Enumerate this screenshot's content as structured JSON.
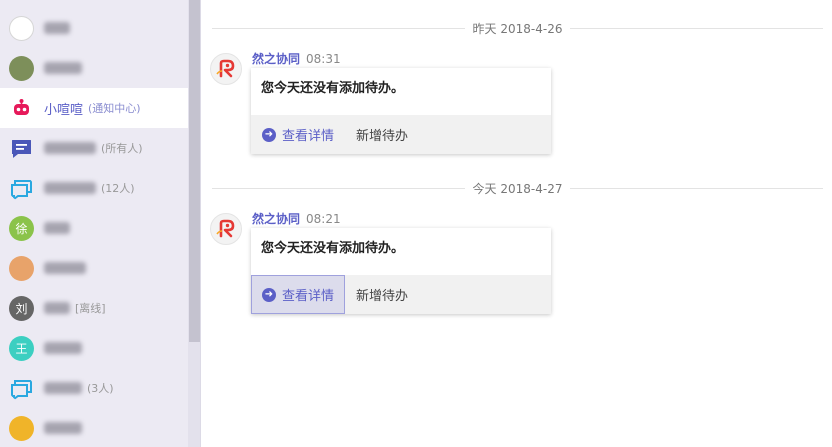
{
  "sidebar": {
    "items": [
      {
        "name": "",
        "sub": "",
        "avatar_text": "",
        "avatar_color": "#ffffff",
        "blur_w": 26
      },
      {
        "name": "",
        "sub": "",
        "avatar_text": "",
        "avatar_color": "#7d8f5a",
        "blur_w": 38
      },
      {
        "name": "小喧喧",
        "sub": "(通知中心)",
        "avatar_text": "",
        "avatar_color": "#e6195a"
      },
      {
        "name": "",
        "sub": "(所有人)",
        "avatar_text": "",
        "avatar_color": "#4a57b8",
        "blur_w": 52
      },
      {
        "name": "",
        "sub": "(12人)",
        "avatar_text": "",
        "avatar_color": "#2aa8e0",
        "blur_w": 52
      },
      {
        "name": "",
        "sub": "",
        "avatar_text": "徐",
        "avatar_color": "#8bc34a",
        "blur_w": 26
      },
      {
        "name": "",
        "sub": "",
        "avatar_text": "",
        "avatar_color": "#e8a36a",
        "blur_w": 42
      },
      {
        "name": "",
        "sub": "[离线]",
        "avatar_text": "刘",
        "avatar_color": "#666666",
        "blur_w": 26
      },
      {
        "name": "",
        "sub": "",
        "avatar_text": "王",
        "avatar_color": "#3ccfc1",
        "blur_w": 38
      },
      {
        "name": "",
        "sub": "(3人)",
        "avatar_text": "",
        "avatar_color": "#2aa8e0",
        "blur_w": 38
      },
      {
        "name": "",
        "sub": "",
        "avatar_text": "",
        "avatar_color": "#f0b429",
        "blur_w": 38
      }
    ]
  },
  "messages": [
    {
      "date": "昨天 2018-4-26",
      "sender": "然之协同",
      "time": "08:31",
      "text": "您今天还没有添加待办。",
      "action_view": "查看详情",
      "action_add": "新增待办"
    },
    {
      "date": "今天 2018-4-27",
      "sender": "然之协同",
      "time": "08:21",
      "text": "您今天还没有添加待办。",
      "action_view": "查看详情",
      "action_add": "新增待办"
    }
  ],
  "colors": {
    "accent": "#5b5fc7",
    "sidebar_bg": "#eceaf3"
  }
}
